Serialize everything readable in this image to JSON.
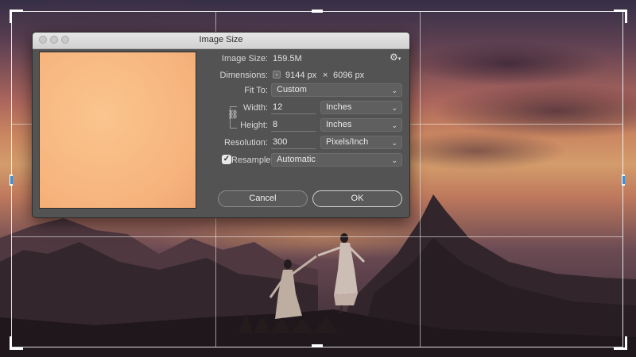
{
  "dialog": {
    "title": "Image Size",
    "image_size_label": "Image Size:",
    "image_size_value": "159.5M",
    "dimensions_label": "Dimensions:",
    "dimensions_width": "9144 px",
    "dimensions_sep": "×",
    "dimensions_height": "6096 px",
    "fit_to_label": "Fit To:",
    "fit_to_value": "Custom",
    "width_label": "Width:",
    "width_value": "12",
    "width_unit": "Inches",
    "height_label": "Height:",
    "height_value": "8",
    "height_unit": "Inches",
    "resolution_label": "Resolution:",
    "resolution_value": "300",
    "resolution_unit": "Pixels/Inch",
    "resample_label": "Resample:",
    "resample_checked": true,
    "resample_value": "Automatic",
    "cancel_label": "Cancel",
    "ok_label": "OK"
  },
  "icons": {
    "gear": "gear-icon",
    "chain": "chain-link-icon",
    "chevron": "chevron-down-icon",
    "check": "checkmark-icon"
  },
  "colors": {
    "dialog_bg": "#535353",
    "titlebar": "#dcdcdc",
    "preview_fill": "#f6b47c",
    "crop_handle_blue": "#3a8fd6"
  }
}
